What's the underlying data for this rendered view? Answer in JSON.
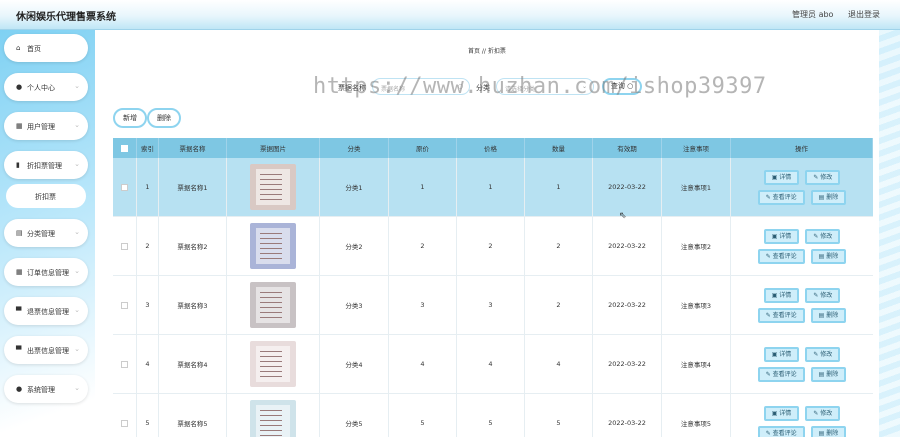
{
  "header": {
    "title": "休闲娱乐代理售票系统",
    "admin_label": "管理员 abo",
    "logout_label": "退出登录"
  },
  "sidebar": {
    "items": [
      {
        "label": "首页",
        "icon": "home-icon",
        "glyph": "⌂",
        "chevron": false
      },
      {
        "label": "个人中心",
        "icon": "user-icon",
        "glyph": "●",
        "chevron": true
      },
      {
        "label": "用户管理",
        "icon": "grid-icon",
        "glyph": "▦",
        "chevron": true
      },
      {
        "label": "折扣票管理",
        "icon": "chart-icon",
        "glyph": "▮",
        "chevron": true
      },
      {
        "label": "分类管理",
        "icon": "list-icon",
        "glyph": "▤",
        "chevron": true
      },
      {
        "label": "订单信息管理",
        "icon": "grid-icon",
        "glyph": "▦",
        "chevron": true
      },
      {
        "label": "退票信息管理",
        "icon": "monitor-icon",
        "glyph": "▀",
        "chevron": true
      },
      {
        "label": "出票信息管理",
        "icon": "monitor-icon",
        "glyph": "▀",
        "chevron": true
      },
      {
        "label": "系统管理",
        "icon": "user-icon",
        "glyph": "●",
        "chevron": true
      }
    ],
    "sub_item": "折扣票"
  },
  "breadcrumb": "首页 // 折扣票",
  "search": {
    "name_label": "票据名称",
    "name_placeholder": "票据名称",
    "category_label": "分类",
    "category_placeholder": "请选择分类",
    "query_label": "查询"
  },
  "actions": {
    "add": "新增",
    "delete": "删除"
  },
  "table": {
    "headers": [
      "",
      "索引",
      "票据名称",
      "票据图片",
      "分类",
      "原价",
      "价格",
      "数量",
      "有效期",
      "注意事项",
      "操作"
    ],
    "rows": [
      {
        "index": "1",
        "name": "票据名称1",
        "category": "分类1",
        "orig": "1",
        "price": "1",
        "qty": "1",
        "valid": "2022-03-22",
        "note": "注意事项1",
        "img": "#d9c9c4"
      },
      {
        "index": "2",
        "name": "票据名称2",
        "category": "分类2",
        "orig": "2",
        "price": "2",
        "qty": "2",
        "valid": "2022-03-22",
        "note": "注意事项2",
        "img": "#aab4d8"
      },
      {
        "index": "3",
        "name": "票据名称3",
        "category": "分类3",
        "orig": "3",
        "price": "3",
        "qty": "2",
        "valid": "2022-03-22",
        "note": "注意事项3",
        "img": "#c8c2c4"
      },
      {
        "index": "4",
        "name": "票据名称4",
        "category": "分类4",
        "orig": "4",
        "price": "4",
        "qty": "4",
        "valid": "2022-03-22",
        "note": "注意事项4",
        "img": "#e8dcdc"
      },
      {
        "index": "5",
        "name": "票据名称5",
        "category": "分类5",
        "orig": "5",
        "price": "5",
        "qty": "5",
        "valid": "2022-03-22",
        "note": "注意事项5",
        "img": "#cfe3ea"
      }
    ],
    "op_labels": {
      "detail": "详情",
      "edit": "修改",
      "comments": "查看评论",
      "delete": "删除"
    }
  },
  "watermark": "https://www.huzhan.com/ishop39397"
}
